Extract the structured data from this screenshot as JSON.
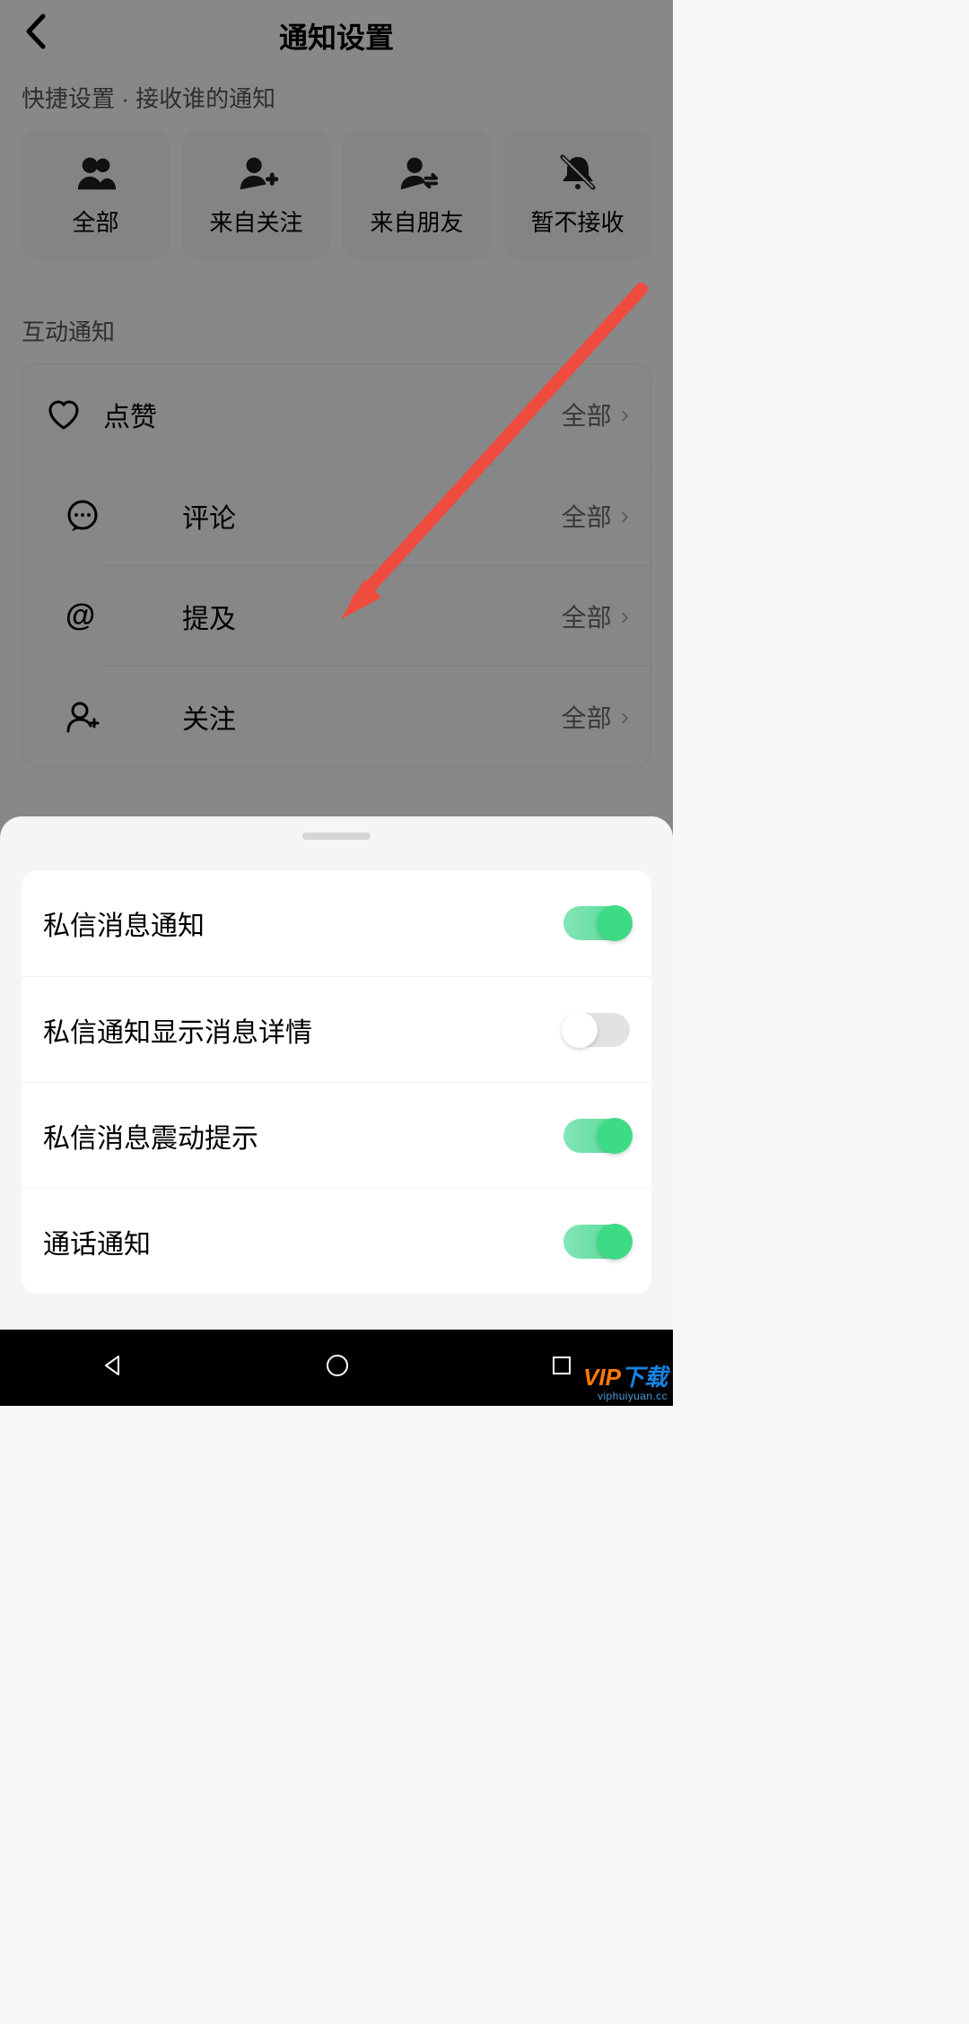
{
  "header": {
    "title": "通知设置"
  },
  "quick": {
    "label": "快捷设置 · 接收谁的通知",
    "items": [
      {
        "label": "全部",
        "icon": "people"
      },
      {
        "label": "来自关注",
        "icon": "person-plus"
      },
      {
        "label": "来自朋友",
        "icon": "person-swap"
      },
      {
        "label": "暂不接收",
        "icon": "bell-off"
      }
    ]
  },
  "interaction": {
    "label": "互动通知",
    "items": [
      {
        "label": "点赞",
        "icon": "heart",
        "value": "全部"
      },
      {
        "label": "评论",
        "icon": "comment",
        "value": "全部"
      },
      {
        "label": "提及",
        "icon": "at",
        "value": "全部"
      },
      {
        "label": "关注",
        "icon": "person-plus",
        "value": "全部"
      }
    ]
  },
  "sheet": {
    "items": [
      {
        "label": "私信消息通知",
        "on": true
      },
      {
        "label": "私信通知显示消息详情",
        "on": false
      },
      {
        "label": "私信消息震动提示",
        "on": true
      },
      {
        "label": "通话通知",
        "on": true
      }
    ]
  },
  "watermark": {
    "brand_a": "VIP",
    "brand_b": "下载",
    "url": "viphuiyuan.cc"
  }
}
